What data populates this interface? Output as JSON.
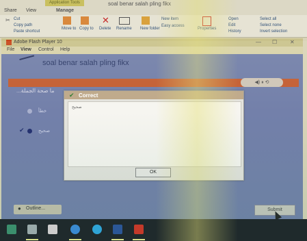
{
  "explorer": {
    "tabs": [
      "Share",
      "View",
      "Manage"
    ],
    "context_tab": "Application Tools",
    "title": "soal benar salah pling fikx",
    "ribbon": {
      "cut": "Cut",
      "copy_path": "Copy path",
      "paste_shortcut": "Paste shortcut",
      "move_to": "Move to",
      "copy_to": "Copy to",
      "delete": "Delete",
      "rename": "Rename",
      "new_folder": "New folder",
      "new_item": "New item",
      "easy_access": "Easy access",
      "properties": "Properties",
      "open": "Open",
      "edit": "Edit",
      "history": "History",
      "select_all": "Select all",
      "select_none": "Select none",
      "invert_selection": "Invert selection"
    }
  },
  "flash": {
    "window_title": "Adobe Flash Player 10",
    "menu": [
      "File",
      "View",
      "Control",
      "Help"
    ],
    "quiz_title": "soal benar salah pling fikx",
    "question": "...ما صحة الجملة",
    "options": [
      {
        "text": "خطأ",
        "checked": false
      },
      {
        "text": "صحيح",
        "checked": true
      }
    ],
    "outline_label": "Outline...",
    "submit_label": "Submit"
  },
  "dialog": {
    "title": "Correct",
    "message": "صحيح",
    "ok_label": "OK"
  },
  "colors": {
    "flash_bg": "#7380aa",
    "red_bar": "#c35e33",
    "taskbar": "#1f2a2c"
  }
}
